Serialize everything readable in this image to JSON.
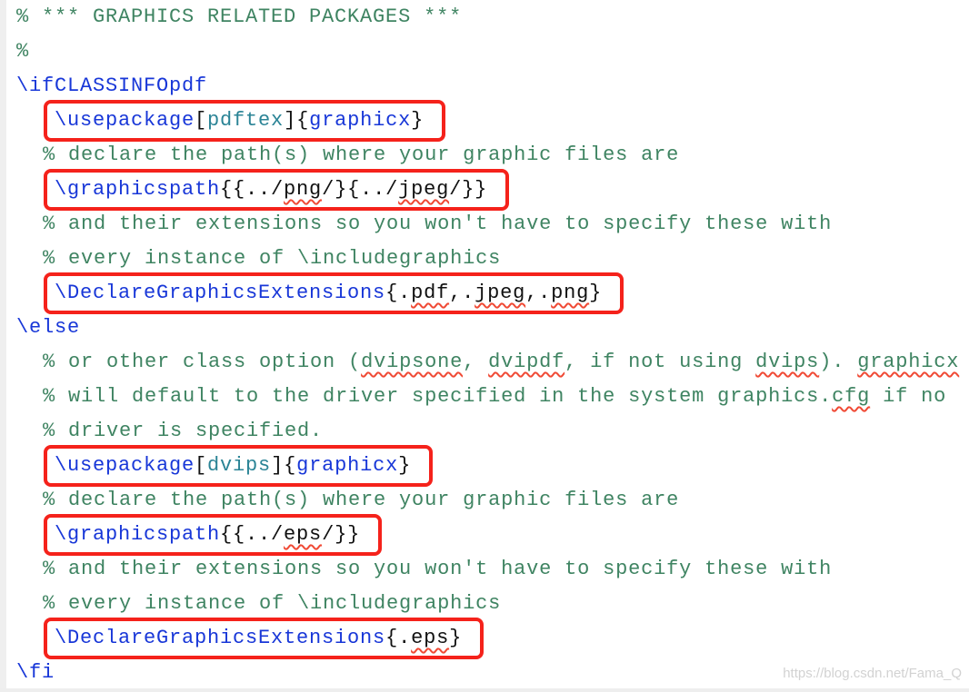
{
  "colors": {
    "comment": "#3f8462",
    "command": "#1837d8",
    "option": "#2b8496",
    "highlight_box": "#f5221b",
    "spellcheck": "#f04a35"
  },
  "lines": [
    {
      "indent": "none",
      "boxed": false,
      "segments": [
        {
          "t": "% *** GRAPHICS RELATED PACKAGES ***",
          "k": "comment"
        }
      ]
    },
    {
      "indent": "none",
      "boxed": false,
      "segments": [
        {
          "t": "%",
          "k": "comment"
        }
      ]
    },
    {
      "indent": "none",
      "boxed": false,
      "segments": [
        {
          "t": "\\ifCLASSINFOpdf",
          "k": "cmd"
        }
      ]
    },
    {
      "indent": "box",
      "boxed": true,
      "segments": [
        {
          "t": "\\usepackage",
          "k": "cmd"
        },
        {
          "t": "[",
          "k": "plain"
        },
        {
          "t": "pdftex",
          "k": "opt"
        },
        {
          "t": "]{",
          "k": "plain"
        },
        {
          "t": "graphicx",
          "k": "cmd"
        },
        {
          "t": "}",
          "k": "plain"
        }
      ]
    },
    {
      "indent": "comment",
      "boxed": false,
      "segments": [
        {
          "t": "% declare the path(s) where your graphic files are",
          "k": "comment"
        }
      ]
    },
    {
      "indent": "box",
      "boxed": true,
      "segments": [
        {
          "t": "\\graphicspath",
          "k": "cmd"
        },
        {
          "t": "{{../",
          "k": "plain"
        },
        {
          "t": "png",
          "k": "plain",
          "sq": true
        },
        {
          "t": "/}{../",
          "k": "plain"
        },
        {
          "t": "jpeg",
          "k": "plain",
          "sq": true
        },
        {
          "t": "/}}",
          "k": "plain"
        }
      ]
    },
    {
      "indent": "comment",
      "boxed": false,
      "segments": [
        {
          "t": "% and their extensions so you won't have to specify these with",
          "k": "comment"
        }
      ]
    },
    {
      "indent": "comment",
      "boxed": false,
      "segments": [
        {
          "t": "% every instance of \\includegraphics",
          "k": "comment"
        }
      ]
    },
    {
      "indent": "box",
      "boxed": true,
      "segments": [
        {
          "t": "\\DeclareGraphicsExtensions",
          "k": "cmd"
        },
        {
          "t": "{.",
          "k": "plain"
        },
        {
          "t": "pdf",
          "k": "plain",
          "sq": true
        },
        {
          "t": ",.",
          "k": "plain"
        },
        {
          "t": "jpeg",
          "k": "plain",
          "sq": true
        },
        {
          "t": ",.",
          "k": "plain"
        },
        {
          "t": "png",
          "k": "plain",
          "sq": true
        },
        {
          "t": "}",
          "k": "plain"
        }
      ]
    },
    {
      "indent": "none",
      "boxed": false,
      "segments": [
        {
          "t": "\\else",
          "k": "cmd"
        }
      ]
    },
    {
      "indent": "comment",
      "boxed": false,
      "segments": [
        {
          "t": "% or other class option (",
          "k": "comment"
        },
        {
          "t": "dvipsone",
          "k": "comment",
          "sq": true
        },
        {
          "t": ", ",
          "k": "comment"
        },
        {
          "t": "dvipdf",
          "k": "comment",
          "sq": true
        },
        {
          "t": ", if not using ",
          "k": "comment"
        },
        {
          "t": "dvips",
          "k": "comment",
          "sq": true
        },
        {
          "t": "). ",
          "k": "comment"
        },
        {
          "t": "graphicx",
          "k": "comment",
          "sq": true
        }
      ]
    },
    {
      "indent": "comment",
      "boxed": false,
      "segments": [
        {
          "t": "% will default to the driver specified in the system graphics.",
          "k": "comment"
        },
        {
          "t": "cfg",
          "k": "comment",
          "sq": true
        },
        {
          "t": " if no",
          "k": "comment"
        }
      ]
    },
    {
      "indent": "comment",
      "boxed": false,
      "segments": [
        {
          "t": "% driver is specified.",
          "k": "comment"
        }
      ]
    },
    {
      "indent": "box",
      "boxed": true,
      "segments": [
        {
          "t": "\\usepackage",
          "k": "cmd"
        },
        {
          "t": "[",
          "k": "plain"
        },
        {
          "t": "dvips",
          "k": "opt"
        },
        {
          "t": "]{",
          "k": "plain"
        },
        {
          "t": "graphicx",
          "k": "cmd"
        },
        {
          "t": "}",
          "k": "plain"
        }
      ]
    },
    {
      "indent": "comment",
      "boxed": false,
      "segments": [
        {
          "t": "% declare the path(s) where your graphic files are",
          "k": "comment"
        }
      ]
    },
    {
      "indent": "box",
      "boxed": true,
      "segments": [
        {
          "t": "\\graphicspath",
          "k": "cmd"
        },
        {
          "t": "{{../",
          "k": "plain"
        },
        {
          "t": "eps",
          "k": "plain",
          "sq": true
        },
        {
          "t": "/}}",
          "k": "plain"
        }
      ]
    },
    {
      "indent": "comment",
      "boxed": false,
      "segments": [
        {
          "t": "% and their extensions so you won't have to specify these with",
          "k": "comment"
        }
      ]
    },
    {
      "indent": "comment",
      "boxed": false,
      "segments": [
        {
          "t": "% every instance of \\includegraphics",
          "k": "comment"
        }
      ]
    },
    {
      "indent": "box",
      "boxed": true,
      "segments": [
        {
          "t": "\\DeclareGraphicsExtensions",
          "k": "cmd"
        },
        {
          "t": "{.",
          "k": "plain"
        },
        {
          "t": "eps",
          "k": "plain",
          "sq": true
        },
        {
          "t": "}",
          "k": "plain"
        }
      ]
    },
    {
      "indent": "none",
      "boxed": false,
      "segments": [
        {
          "t": "\\fi",
          "k": "cmd"
        }
      ]
    }
  ],
  "watermark": "https://blog.csdn.net/Fama_Q"
}
